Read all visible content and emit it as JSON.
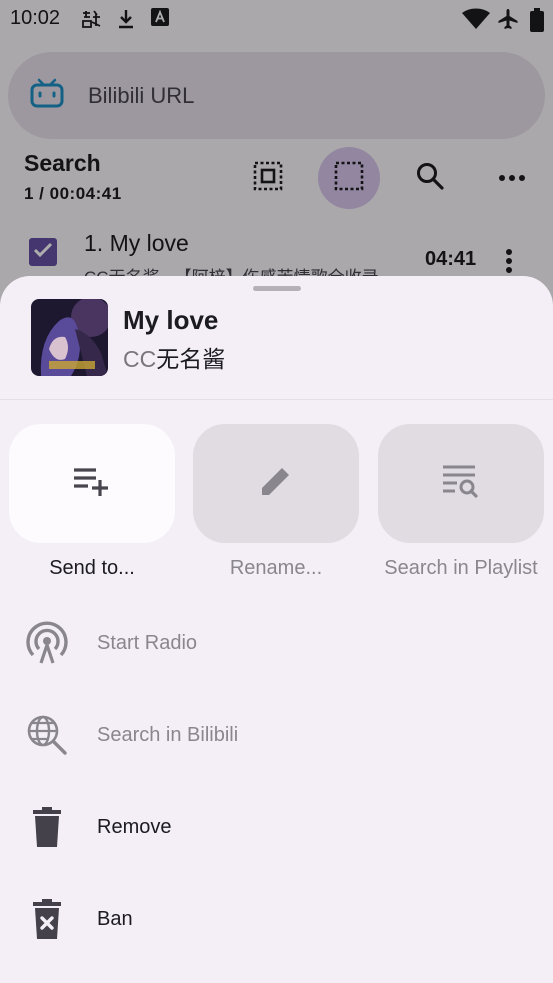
{
  "status_bar": {
    "time": "10:02",
    "icons": [
      "wechat-icon",
      "download-icon",
      "font-a-icon",
      "wifi-icon",
      "airplane-icon",
      "battery-icon"
    ]
  },
  "search": {
    "placeholder": "Bilibili URL",
    "icon": "bilibili-tv-icon"
  },
  "playlist_header": {
    "title": "Search",
    "subtitle": "1 / 00:04:41"
  },
  "toolbar": {
    "icons": [
      "select-all-icon",
      "select-icon",
      "search-icon",
      "more-horiz-icon"
    ],
    "active": "select-icon"
  },
  "track_row": {
    "checked": true,
    "title": "1. My love",
    "subtitle": "CC无名酱 - 【阿梓】伤感苦情歌全收录",
    "duration": "04:41"
  },
  "sheet": {
    "song_title": "My love",
    "artist_prefix": "CC",
    "artist_rest": "无名酱",
    "quick_actions": [
      {
        "label": "Send to...",
        "icon": "playlist-add-icon",
        "enabled": true
      },
      {
        "label": "Rename...",
        "icon": "edit-pencil-icon",
        "enabled": false
      },
      {
        "label": "Search in Playlist",
        "icon": "playlist-search-icon",
        "enabled": false
      }
    ],
    "menu_items": [
      {
        "label": "Start Radio",
        "icon": "radio-podcast-icon",
        "enabled": false
      },
      {
        "label": "Search in Bilibili",
        "icon": "globe-search-icon",
        "enabled": false
      },
      {
        "label": "Remove",
        "icon": "trash-icon",
        "enabled": true
      },
      {
        "label": "Ban",
        "icon": "trash-x-icon",
        "enabled": true
      }
    ]
  },
  "colors": {
    "accent": "#6750a4",
    "active_button": "#d8c6ee",
    "sheet_bg": "#f4eff6",
    "disabled_text": "#8a868e"
  }
}
